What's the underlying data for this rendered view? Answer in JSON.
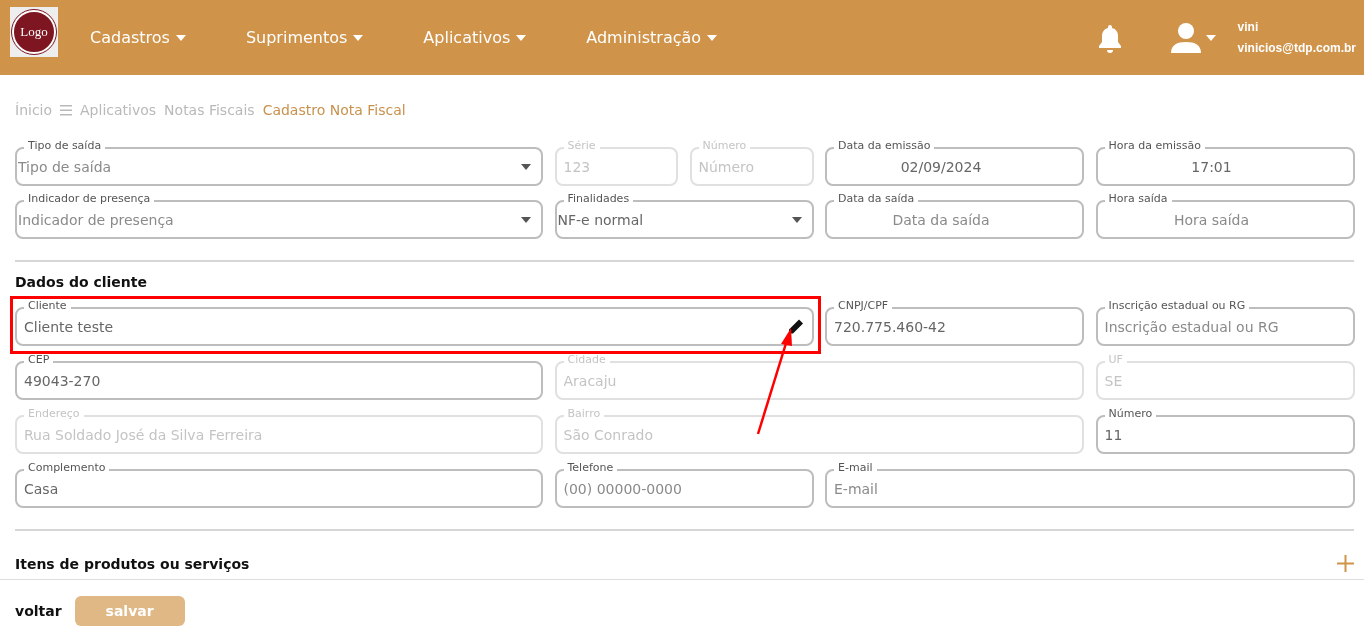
{
  "header": {
    "logo_text": "Logo",
    "nav": [
      {
        "label": "Cadastros"
      },
      {
        "label": "Suprimentos"
      },
      {
        "label": "Aplicativos"
      },
      {
        "label": "Administração"
      }
    ],
    "user": {
      "name": "vini",
      "email": "vinicios@tdp.com.br"
    }
  },
  "breadcrumb": [
    {
      "label": "Ínicio",
      "current": false,
      "menu_icon": false
    },
    {
      "label": "Aplicativos",
      "current": false,
      "menu_icon": true
    },
    {
      "label": "Notas Fiscais",
      "current": false,
      "menu_icon": false
    },
    {
      "label": "Cadastro Nota Fiscal",
      "current": true,
      "menu_icon": false
    }
  ],
  "invoice_fields": [
    {
      "label": "Tipo de saída",
      "kind": "select",
      "placeholder": "Tipo de saída",
      "disabled": false
    },
    {
      "label": "Série",
      "kind": "text",
      "value": "123",
      "disabled": true
    },
    {
      "label": "Número",
      "kind": "text",
      "placeholder": "Número",
      "disabled": true
    },
    {
      "label": "Data da emissão",
      "kind": "date",
      "value": "02/09/2024",
      "disabled": false
    },
    {
      "label": "Hora da emissão",
      "kind": "time",
      "value": "17:01",
      "disabled": false
    },
    {
      "label": "Indicador de presença",
      "kind": "select",
      "placeholder": "Indicador de presença",
      "disabled": false
    },
    {
      "label": "Finalidades",
      "kind": "select",
      "value": "NF-e normal",
      "disabled": false
    },
    {
      "label": "Data da saída",
      "kind": "date",
      "placeholder": "Data da saída",
      "disabled": false
    },
    {
      "label": "Hora saída",
      "kind": "time",
      "placeholder": "Hora saída",
      "disabled": false
    }
  ],
  "client_section": {
    "title": "Dados do cliente",
    "fields": [
      {
        "label": "Cliente",
        "kind": "edit",
        "value": "Cliente teste",
        "disabled": false
      },
      {
        "label": "CNPJ/CPF",
        "kind": "text",
        "value": "720.775.460-42",
        "disabled": false
      },
      {
        "label": "Inscrição estadual ou RG",
        "kind": "text",
        "placeholder": "Inscrição estadual ou RG",
        "disabled": false
      },
      {
        "label": "CEP",
        "kind": "text",
        "value": "49043-270",
        "disabled": false
      },
      {
        "label": "Cidade",
        "kind": "text",
        "value": "Aracaju",
        "disabled": true
      },
      {
        "label": "UF",
        "kind": "text",
        "value": "SE",
        "disabled": true
      },
      {
        "label": "Endereço",
        "kind": "text",
        "value": "Rua Soldado José da Silva Ferreira",
        "disabled": true
      },
      {
        "label": "Bairro",
        "kind": "text",
        "value": "São Conrado",
        "disabled": true
      },
      {
        "label": "Número",
        "kind": "text",
        "value": "11",
        "disabled": false
      },
      {
        "label": "Complemento",
        "kind": "text",
        "value": "Casa",
        "disabled": false
      },
      {
        "label": "Telefone",
        "kind": "text",
        "placeholder": "(00) 00000-0000",
        "disabled": false
      },
      {
        "label": "E-mail",
        "kind": "text",
        "placeholder": "E-mail",
        "disabled": false
      }
    ]
  },
  "items_section": {
    "title": "Itens de produtos ou serviços"
  },
  "footer": {
    "back_label": "voltar",
    "save_label": "salvar",
    "save_disabled": true
  }
}
